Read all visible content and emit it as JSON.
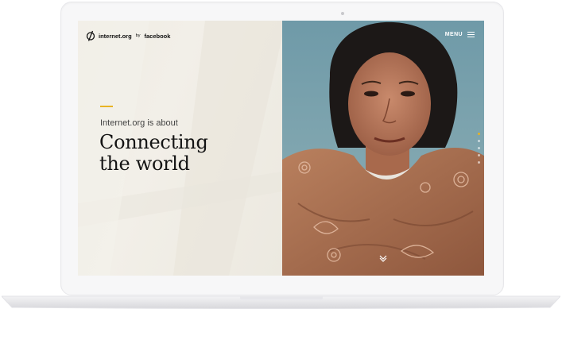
{
  "brand": {
    "name": "internet.org",
    "by": "by",
    "partner": "facebook"
  },
  "nav": {
    "menu_label": "MENU"
  },
  "hero": {
    "eyebrow": "Internet.org is about",
    "headline_line1": "Connecting",
    "headline_line2": "the world"
  },
  "slides": {
    "count": 5,
    "active_index": 0
  },
  "colors": {
    "accent": "#e8b323",
    "left_panel_bg": "#efece3",
    "headline": "#141414"
  },
  "icons": {
    "logo": "internet-org-logo-icon",
    "menu": "hamburger-icon",
    "scroll": "chevron-down-icon"
  }
}
